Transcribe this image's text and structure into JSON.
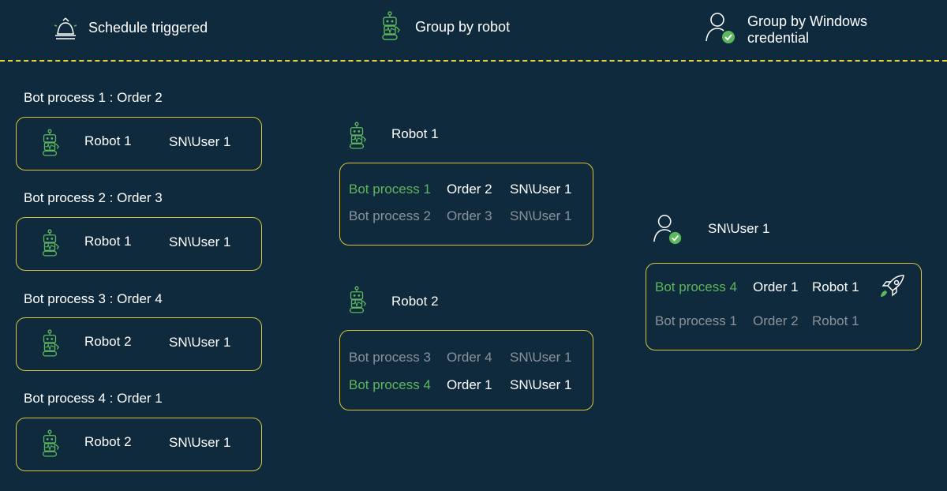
{
  "header": {
    "schedule": "Schedule triggered",
    "group_robot": "Group by robot",
    "group_windows_line1": "Group by Windows",
    "group_windows_line2": "credential"
  },
  "left_column": [
    {
      "title": "Bot process 1 :  Order 2",
      "robot": "Robot 1",
      "user": "SN\\User 1"
    },
    {
      "title": "Bot process 2 :  Order 3",
      "robot": "Robot 1",
      "user": "SN\\User 1"
    },
    {
      "title": "Bot process 3  :  Order 4",
      "robot": "Robot 2",
      "user": "SN\\User 1"
    },
    {
      "title": "Bot process 4  :  Order 1",
      "robot": "Robot 2",
      "user": "SN\\User 1"
    }
  ],
  "middle_column": [
    {
      "robot": "Robot 1",
      "rows": [
        {
          "process": "Bot process 1",
          "order": "Order 2",
          "user": "SN\\User 1",
          "state": "active"
        },
        {
          "process": "Bot process 2",
          "order": "Order 3",
          "user": "SN\\User 1",
          "state": "queued"
        }
      ]
    },
    {
      "robot": "Robot 2",
      "rows": [
        {
          "process": "Bot process 3",
          "order": "Order 4",
          "user": "SN\\User 1",
          "state": "queued"
        },
        {
          "process": "Bot process 4",
          "order": "Order 1",
          "user": "SN\\User 1",
          "state": "active"
        }
      ]
    }
  ],
  "right_column": {
    "user": "SN\\User 1",
    "rows": [
      {
        "process": "Bot process 4",
        "order": "Order 1",
        "robot": "Robot 1",
        "state": "active"
      },
      {
        "process": "Bot process 1",
        "order": "Order 2",
        "robot": "Robot 1",
        "state": "queued"
      }
    ]
  },
  "colors": {
    "background": "#0f2a3d",
    "accent_yellow": "#d8c53e",
    "green": "#5cb85c",
    "grey": "#8a939a"
  }
}
